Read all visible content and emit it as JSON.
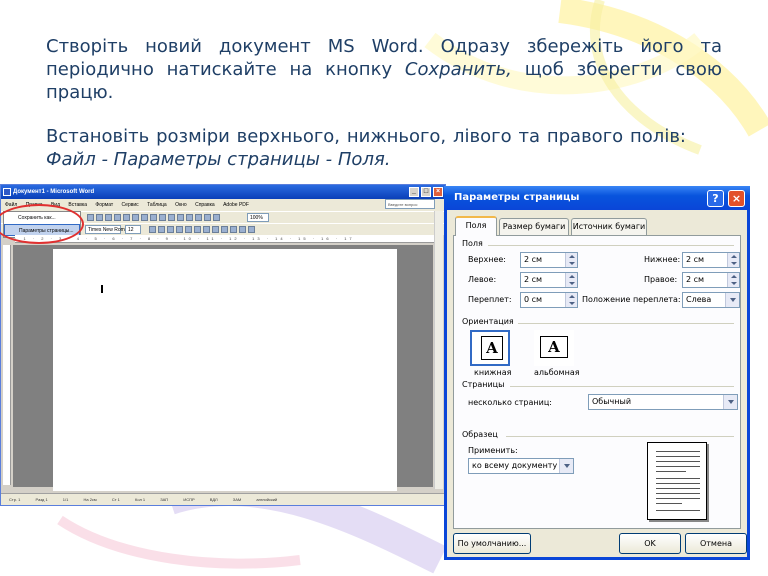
{
  "slide": {
    "paragraph1": {
      "text_a": "Створіть новий документ MS Word. Одразу збережіть його та періодично натискайте на кнопку ",
      "text_italic": "Сохранить,",
      "text_b": " щоб зберегти свою працю."
    },
    "paragraph2": {
      "text_a": "Встановіть розміри верхнього, нижнього, лівого та правого полів: ",
      "text_italic": "Файл - Параметры страницы - Поля."
    }
  },
  "word_window": {
    "title": "Документ1 - Microsoft Word",
    "menu": [
      "Файл",
      "Правка",
      "Вид",
      "Вставка",
      "Формат",
      "Сервис",
      "Таблица",
      "Окно",
      "Справка",
      "Adobe PDF"
    ],
    "search_placeholder": "Введите вопрос",
    "zoom": "100%",
    "font_name": "Times New Roman",
    "font_size": "12",
    "file_menu": [
      "Сохранить как...",
      "Параметры страницы..."
    ],
    "ruler_text": "· 1 · 2 · 3 · 4 · 5 · 6 · 7 · 8 · 9 · 10 · 11 · 12 · 13 · 14 · 15 · 16 · 17",
    "status": [
      "Стр. 1",
      "Разд 1",
      "1/1",
      "На 2см",
      "Ст 1",
      "Кол 1",
      "ЗАП",
      "ИСПР",
      "ВДЛ",
      "ЗАМ",
      "английский"
    ]
  },
  "dialog": {
    "title": "Параметры страницы",
    "help_icon": "?",
    "close_icon": "×",
    "tabs": [
      "Поля",
      "Размер бумаги",
      "Источник бумаги"
    ],
    "fields_group": "Поля",
    "top_label": "Верхнее:",
    "top_value": "2 см",
    "bottom_label": "Нижнее:",
    "bottom_value": "2 см",
    "left_label": "Левое:",
    "left_value": "2 см",
    "right_label": "Правое:",
    "right_value": "2 см",
    "gutter_label": "Переплет:",
    "gutter_value": "0 см",
    "gutter_pos_label": "Положение переплета:",
    "gutter_pos_value": "Слева",
    "orientation_group": "Ориентация",
    "portrait_label": "книжная",
    "landscape_label": "альбомная",
    "orientation_glyph": "A",
    "pages_group": "Страницы",
    "multiple_pages_label": "несколько страниц:",
    "multiple_pages_value": "Обычный",
    "sample_group": "Образец",
    "apply_label": "Применить:",
    "apply_value": "ко всему документу",
    "default_button": "По умолчанию...",
    "ok_button": "OK",
    "cancel_button": "Отмена"
  }
}
